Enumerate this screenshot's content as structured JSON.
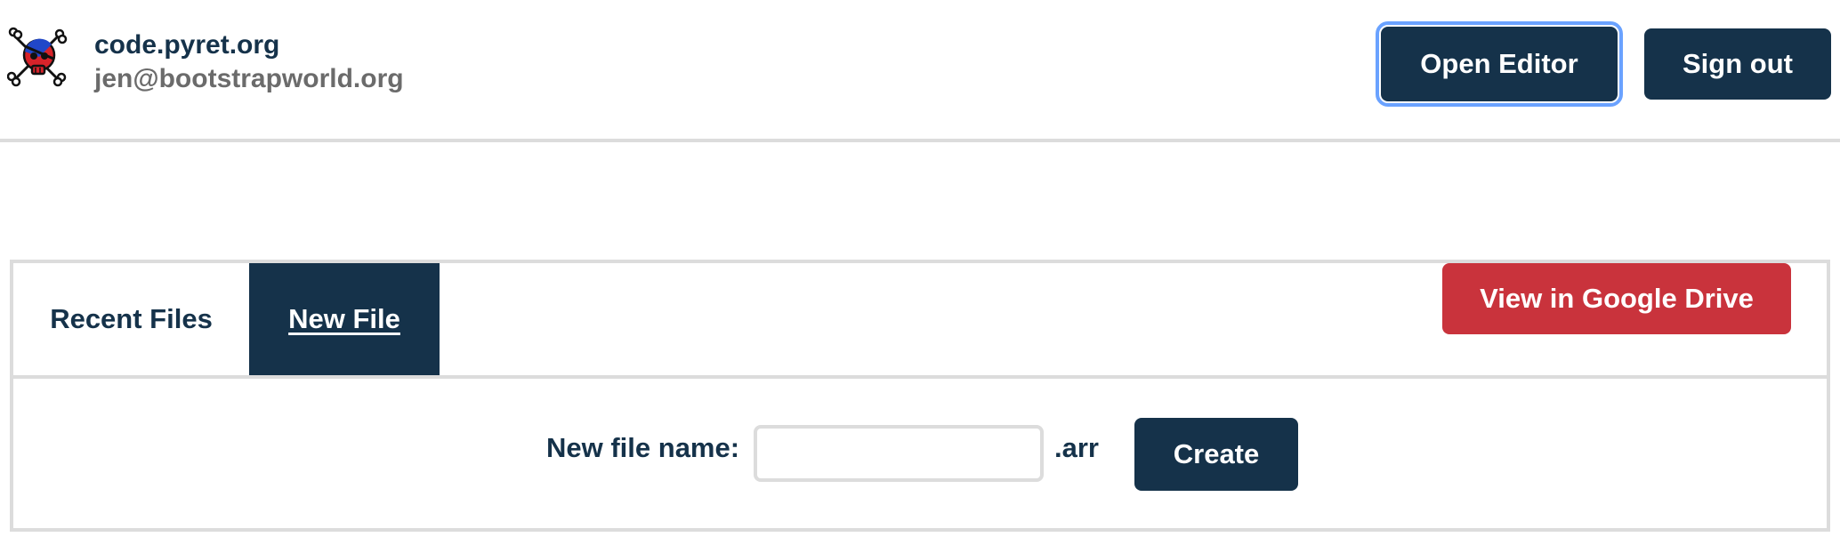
{
  "header": {
    "site_title": "code.pyret.org",
    "user_email": "jen@bootstrapworld.org",
    "logo_icon": "pyret-skull-logo-icon",
    "open_editor_label": "Open Editor",
    "sign_out_label": "Sign out"
  },
  "tabs": [
    {
      "label": "Recent Files",
      "active": false
    },
    {
      "label": "New File",
      "active": true
    }
  ],
  "drive_button_label": "View in Google Drive",
  "new_file_form": {
    "label": "New file name:",
    "value": "",
    "placeholder": "",
    "extension": ".arr",
    "create_label": "Create"
  },
  "colors": {
    "primary": "#15324a",
    "danger": "#c9333c",
    "focus_ring": "#6aa2ff",
    "border": "#dcdcdc",
    "muted_text": "#6b6b6b"
  }
}
